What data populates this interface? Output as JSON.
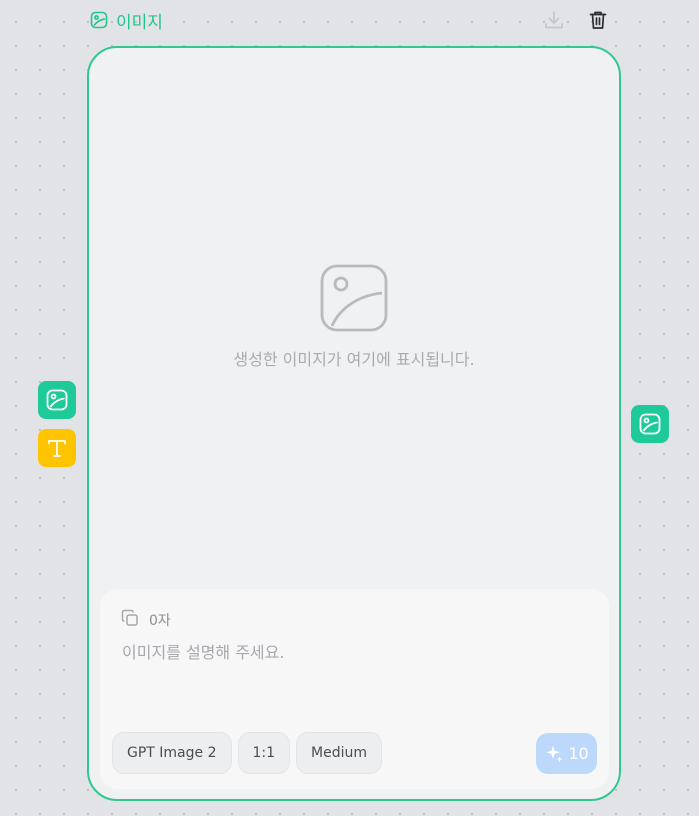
{
  "node": {
    "title": "이미지",
    "placeholder_text": "생성한 이미지가 여기에 표시됩니다.",
    "accent_color": "#2fc98f"
  },
  "header": {
    "icons": [
      "image-icon",
      "download-icon",
      "trash-icon"
    ]
  },
  "prompt": {
    "char_count": "0자",
    "placeholder": "이미지를 설명해 주세요."
  },
  "options": {
    "model": "GPT Image 2",
    "ratio": "1:1",
    "quality": "Medium"
  },
  "generate": {
    "credits": "10",
    "color": "#bcd9fb"
  },
  "side_tiles": {
    "left": [
      {
        "icon": "image-icon",
        "color": "#1ec99a"
      },
      {
        "icon": "text-icon",
        "color": "#ffc400"
      }
    ],
    "right": [
      {
        "icon": "image-icon",
        "color": "#1ec99a"
      }
    ]
  }
}
